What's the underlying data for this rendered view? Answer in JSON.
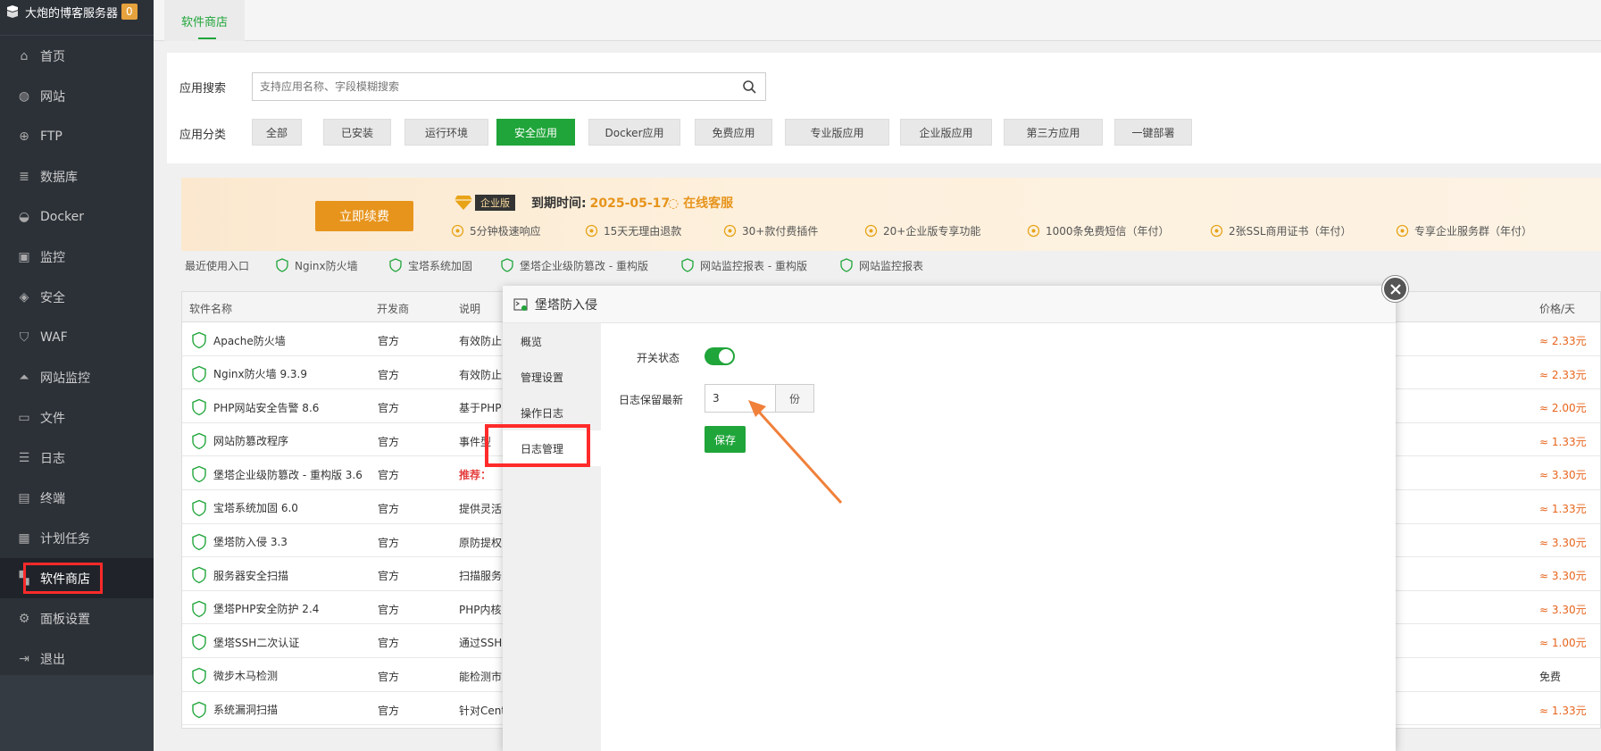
{
  "brand": {
    "title": "大炮的博客服务器",
    "badge": "0"
  },
  "sidebar": {
    "items": [
      {
        "label": "首页",
        "icon": "home-icon"
      },
      {
        "label": "网站",
        "icon": "globe-icon"
      },
      {
        "label": "FTP",
        "icon": "ftp-icon"
      },
      {
        "label": "数据库",
        "icon": "database-icon"
      },
      {
        "label": "Docker",
        "icon": "docker-icon"
      },
      {
        "label": "监控",
        "icon": "monitor-icon"
      },
      {
        "label": "安全",
        "icon": "shield-icon"
      },
      {
        "label": "WAF",
        "icon": "waf-icon"
      },
      {
        "label": "网站监控",
        "icon": "chart-icon"
      },
      {
        "label": "文件",
        "icon": "folder-icon"
      },
      {
        "label": "日志",
        "icon": "log-icon"
      },
      {
        "label": "终端",
        "icon": "terminal-icon"
      },
      {
        "label": "计划任务",
        "icon": "calendar-icon"
      },
      {
        "label": "软件商店",
        "icon": "apps-icon"
      },
      {
        "label": "面板设置",
        "icon": "gear-icon"
      },
      {
        "label": "退出",
        "icon": "logout-icon"
      }
    ],
    "active_index": 13
  },
  "tabbar": {
    "tab_label": "软件商店"
  },
  "search": {
    "label": "应用搜索",
    "placeholder": "支持应用名称、字段模糊搜索"
  },
  "categories": {
    "label": "应用分类",
    "items": [
      "全部",
      "已安装",
      "运行环境",
      "安全应用",
      "Docker应用",
      "免费应用",
      "专业版应用",
      "企业版应用",
      "第三方应用",
      "一键部署"
    ],
    "active": "安全应用"
  },
  "promo": {
    "renew_label": "立即续费",
    "edition": "企业版",
    "expire_label": "到期时间:",
    "expire_date": "2025-05-17",
    "service": "在线客服",
    "features": [
      "5分钟极速响应",
      "15天无理由退款",
      "30+款付费插件",
      "20+企业版专享功能",
      "1000条免费短信（年付）",
      "2张SSL商用证书（年付）",
      "专享企业服务群（年付）"
    ]
  },
  "recent": {
    "label": "最近使用入口",
    "items": [
      "Nginx防火墙",
      "宝塔系统加固",
      "堡塔企业级防篡改 - 重构版",
      "网站监控报表 - 重构版",
      "网站监控报表"
    ]
  },
  "table": {
    "headers": [
      "软件名称",
      "开发商",
      "说明",
      "价格/天"
    ],
    "rows": [
      {
        "name": "Apache防火墙",
        "dev": "官方",
        "desc": "有效防止",
        "price": "≈ 2.33元"
      },
      {
        "name": "Nginx防火墙 9.3.9",
        "dev": "官方",
        "desc": "有效防止",
        "price": "≈ 2.33元"
      },
      {
        "name": "PHP网站安全告警 8.6",
        "dev": "官方",
        "desc": "基于PHP",
        "price": "≈ 2.00元"
      },
      {
        "name": "网站防篡改程序",
        "dev": "官方",
        "desc": "事件型",
        "price": "≈ 1.33元"
      },
      {
        "name": "堡塔企业级防篡改 - 重构版 3.6",
        "dev": "官方",
        "desc": "推荐：",
        "price": "≈ 3.30元",
        "red": true
      },
      {
        "name": "宝塔系统加固 6.0",
        "dev": "官方",
        "desc": "提供灵活",
        "price": "≈ 1.33元"
      },
      {
        "name": "堡塔防入侵 3.3",
        "dev": "官方",
        "desc": "原防提权",
        "price": "≈ 3.30元"
      },
      {
        "name": "服务器安全扫描",
        "dev": "官方",
        "desc": "扫描服务",
        "price": "≈ 3.30元"
      },
      {
        "name": "堡塔PHP安全防护 2.4",
        "dev": "官方",
        "desc": "PHP内核",
        "price": "≈ 3.30元"
      },
      {
        "name": "堡塔SSH二次认证",
        "dev": "官方",
        "desc": "通过SSH",
        "price": "≈ 1.00元"
      },
      {
        "name": "微步木马检测",
        "dev": "官方",
        "desc": "能检测市",
        "price": "免费",
        "free": true
      },
      {
        "name": "系统漏洞扫描",
        "dev": "官方",
        "desc": "针对Cent",
        "price": "≈ 1.33元"
      }
    ]
  },
  "modal": {
    "title": "堡塔防入侵",
    "menu": [
      "概览",
      "管理设置",
      "操作日志",
      "日志管理"
    ],
    "active_menu": "日志管理",
    "switch_label": "开关状态",
    "switch_on": true,
    "retain_label": "日志保留最新",
    "retain_value": "3",
    "retain_unit": "份",
    "save_label": "保存"
  }
}
